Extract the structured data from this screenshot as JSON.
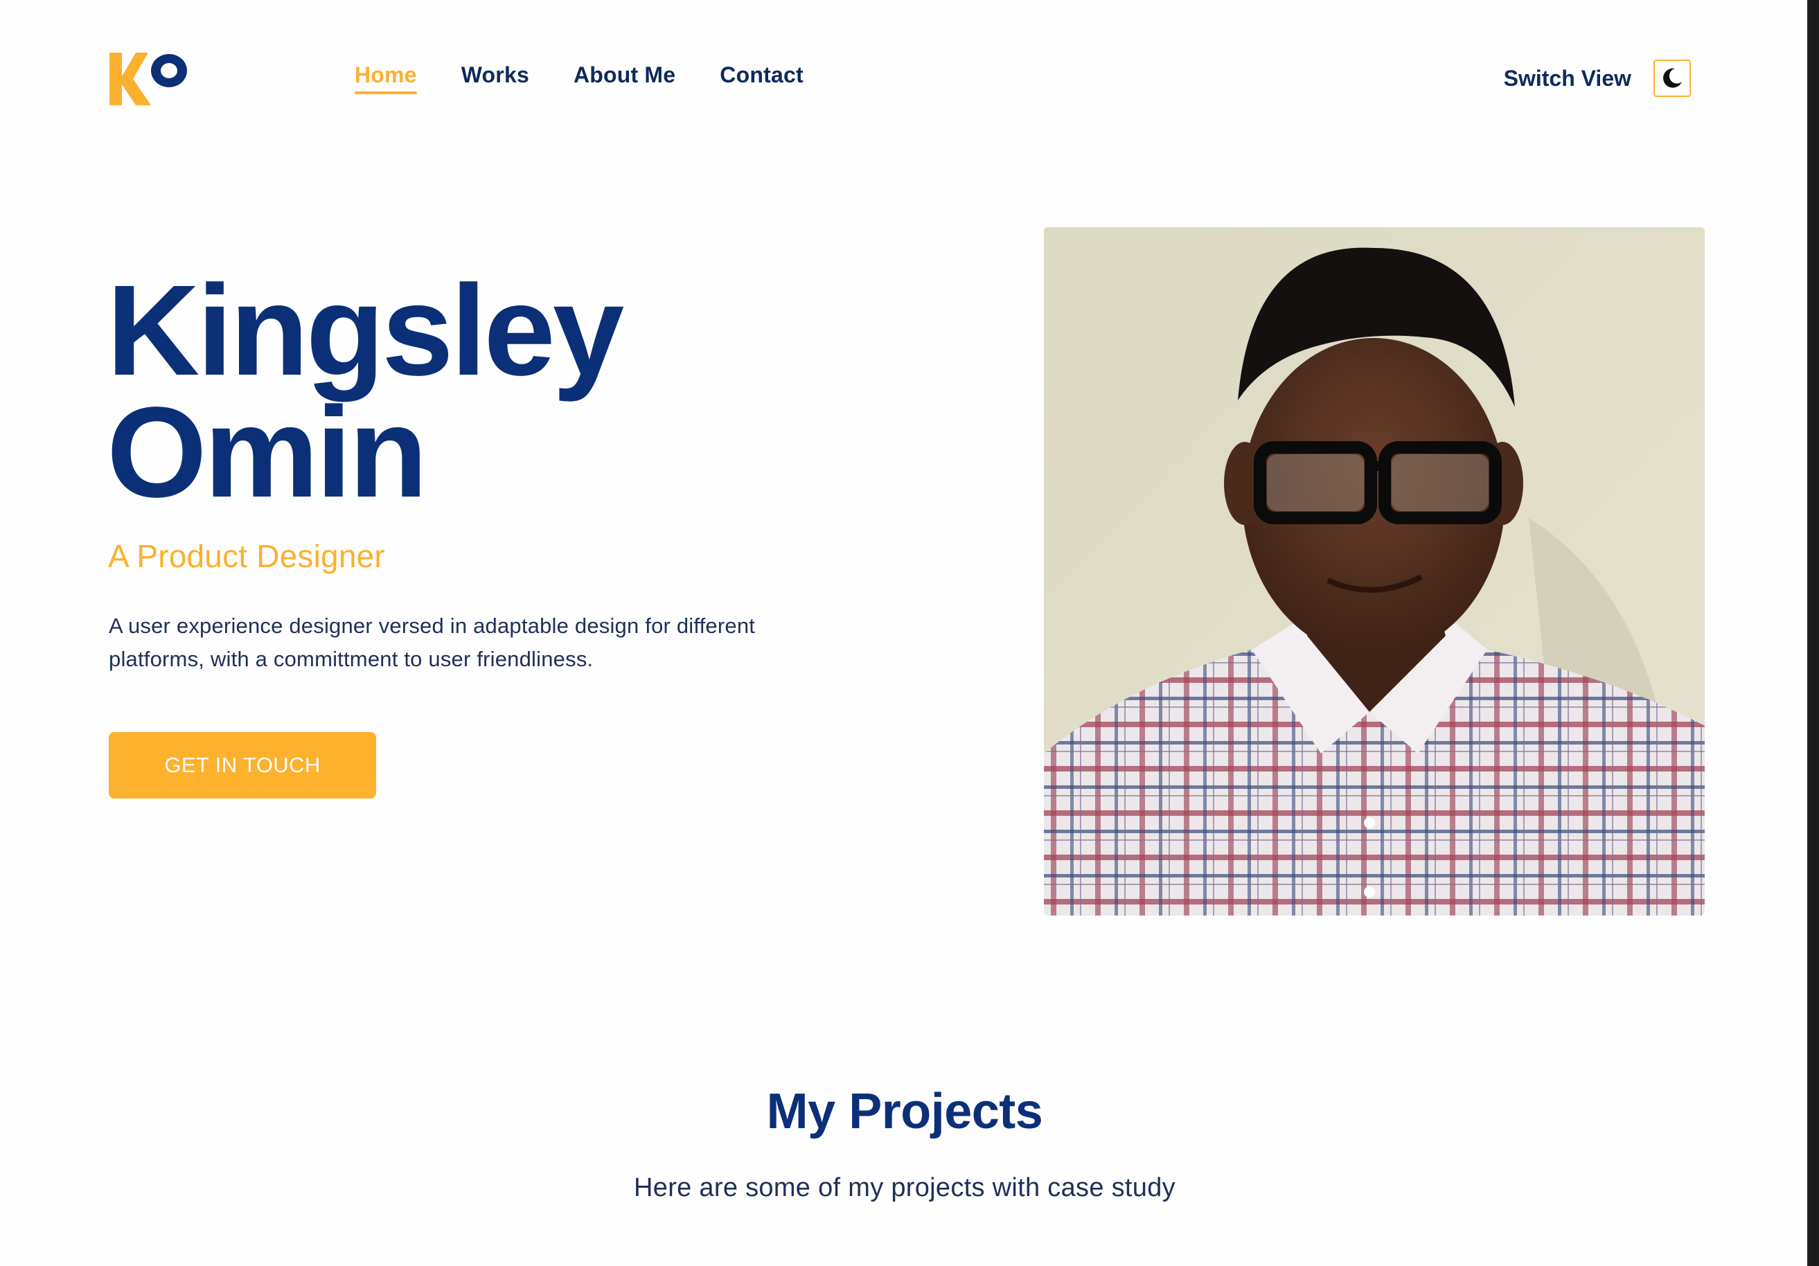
{
  "brand": {
    "logo_text": "KO",
    "accent_color": "#fbb02f",
    "primary_color": "#0b3078"
  },
  "nav": {
    "items": [
      {
        "label": "Home",
        "active": true
      },
      {
        "label": "Works",
        "active": false
      },
      {
        "label": "About Me",
        "active": false
      },
      {
        "label": "Contact",
        "active": false
      }
    ]
  },
  "header": {
    "switch_label": "Switch View",
    "switch_icon": "moon-icon"
  },
  "hero": {
    "first_name": "Kingsley",
    "last_name": "Omin",
    "role": "A Product Designer",
    "description": "A user experience designer versed in adaptable design for different platforms, with a committment to user friendliness.",
    "cta_label": "GET IN TOUCH"
  },
  "projects": {
    "title": "My Projects",
    "subtitle": "Here are some of my projects with case study"
  }
}
